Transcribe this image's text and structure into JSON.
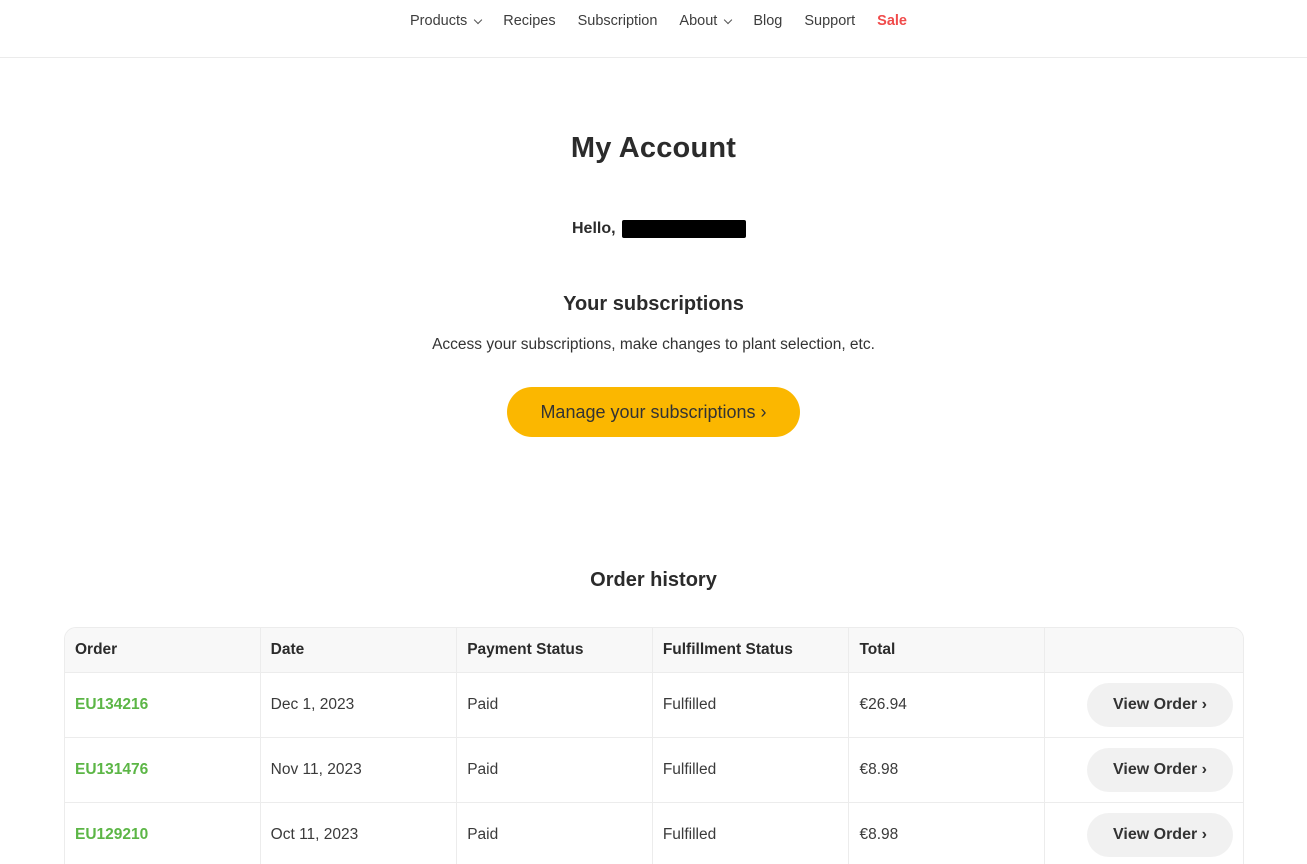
{
  "nav": {
    "items": [
      {
        "label": "Products",
        "has_dropdown": true
      },
      {
        "label": "Recipes",
        "has_dropdown": false
      },
      {
        "label": "Subscription",
        "has_dropdown": false
      },
      {
        "label": "About",
        "has_dropdown": true
      },
      {
        "label": "Blog",
        "has_dropdown": false
      },
      {
        "label": "Support",
        "has_dropdown": false
      },
      {
        "label": "Sale",
        "has_dropdown": false
      }
    ],
    "sale_color": "#f04b4b"
  },
  "account": {
    "title": "My Account",
    "greeting": "Hello,"
  },
  "subscriptions": {
    "title": "Your subscriptions",
    "description": "Access your subscriptions, make changes to plant selection, etc.",
    "button_label": "Manage your subscriptions ›",
    "button_color": "#fbb700"
  },
  "orders": {
    "title": "Order history",
    "columns": [
      "Order",
      "Date",
      "Payment Status",
      "Fulfillment Status",
      "Total",
      ""
    ],
    "rows": [
      {
        "order": "EU134216",
        "date": "Dec 1, 2023",
        "payment": "Paid",
        "fulfillment": "Fulfilled",
        "total": "€26.94",
        "action": "View Order ›"
      },
      {
        "order": "EU131476",
        "date": "Nov 11, 2023",
        "payment": "Paid",
        "fulfillment": "Fulfilled",
        "total": "€8.98",
        "action": "View Order ›"
      },
      {
        "order": "EU129210",
        "date": "Oct 11, 2023",
        "payment": "Paid",
        "fulfillment": "Fulfilled",
        "total": "€8.98",
        "action": "View Order ›"
      }
    ],
    "link_color": "#5cb646"
  }
}
